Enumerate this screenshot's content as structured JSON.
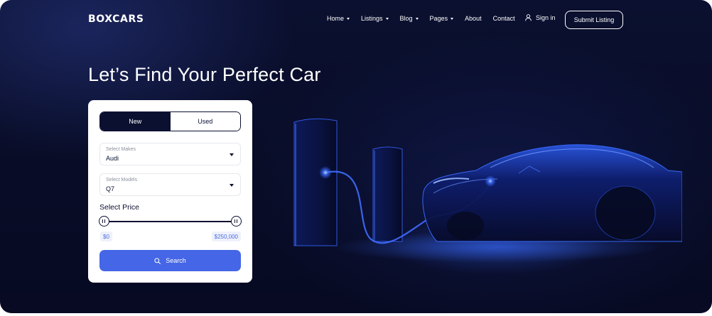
{
  "brand": {
    "logo": "BOXCARS"
  },
  "nav": {
    "items": [
      {
        "label": "Home",
        "has_dropdown": true
      },
      {
        "label": "Listings",
        "has_dropdown": true
      },
      {
        "label": "Blog",
        "has_dropdown": true
      },
      {
        "label": "Pages",
        "has_dropdown": true
      },
      {
        "label": "About",
        "has_dropdown": false
      },
      {
        "label": "Contact",
        "has_dropdown": false
      }
    ],
    "signin_label": "Sign in",
    "signin_icon": "user-icon",
    "submit_label": "Submit Listing"
  },
  "hero": {
    "title": "Let’s Find Your Perfect Car"
  },
  "search_form": {
    "condition_tabs": [
      {
        "label": "New",
        "active": true
      },
      {
        "label": "Used",
        "active": false
      }
    ],
    "makes": {
      "label": "Select Makes",
      "value": "Audi"
    },
    "models": {
      "label": "Select Models",
      "value": "Q7"
    },
    "price": {
      "title": "Select Price",
      "min_label": "$0",
      "max_label": "$250,000",
      "min_fraction": 0,
      "max_fraction": 1
    },
    "search_label": "Search",
    "search_icon": "search-icon"
  },
  "colors": {
    "background": "#080c26",
    "accent": "#4566e6",
    "dark": "#0b1030",
    "glow": "#3a6cff"
  }
}
